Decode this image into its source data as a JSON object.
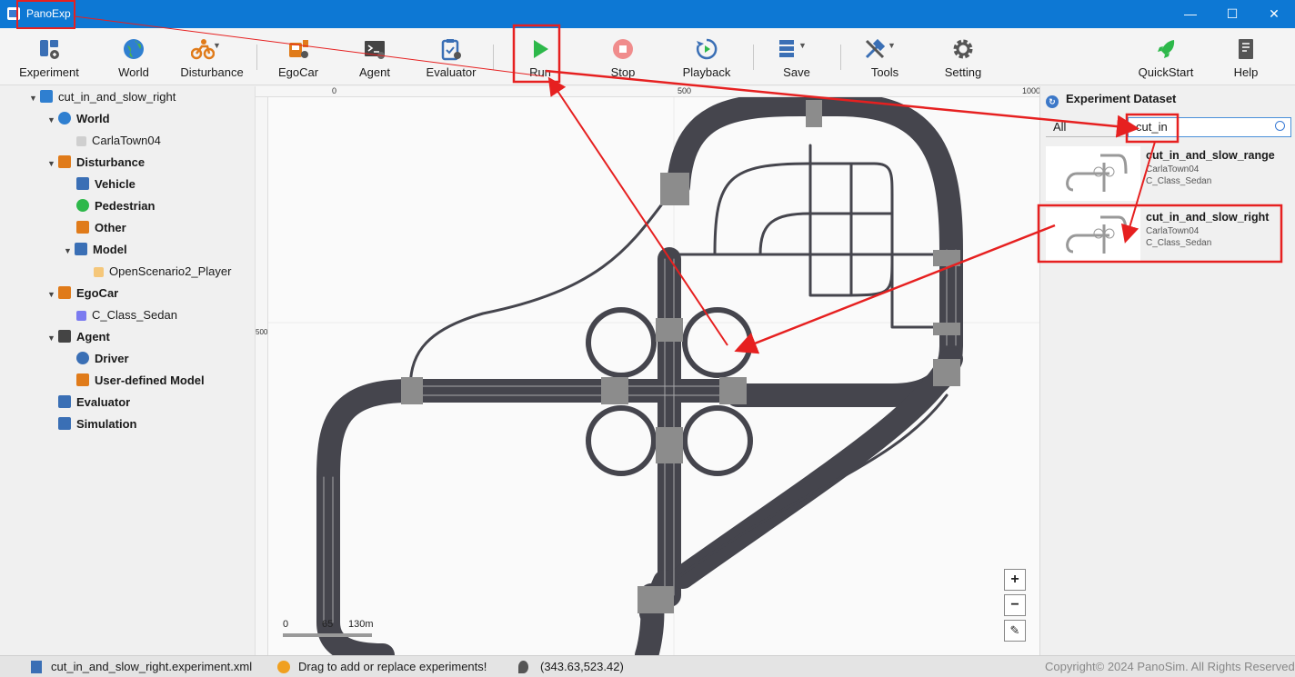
{
  "window": {
    "title": "PanoExp",
    "min": "—",
    "max": "☐",
    "close": "✕"
  },
  "toolbar": {
    "experiment": "Experiment",
    "world": "World",
    "disturbance": "Disturbance",
    "egocar": "EgoCar",
    "agent": "Agent",
    "evaluator": "Evaluator",
    "run": "Run",
    "stop": "Stop",
    "playback": "Playback",
    "save": "Save",
    "tools": "Tools",
    "setting": "Setting",
    "quickstart": "QuickStart",
    "help": "Help"
  },
  "tree": {
    "root": "cut_in_and_slow_right",
    "world": "World",
    "world_child": "CarlaTown04",
    "disturbance": "Disturbance",
    "vehicle": "Vehicle",
    "pedestrian": "Pedestrian",
    "other": "Other",
    "model": "Model",
    "model_child": "OpenScenario2_Player",
    "egocar": "EgoCar",
    "egocar_child": "C_Class_Sedan",
    "agent": "Agent",
    "driver": "Driver",
    "user_model": "User-defined Model",
    "evaluator": "Evaluator",
    "simulation": "Simulation"
  },
  "map": {
    "ruler_x": [
      "0",
      "500",
      "1000"
    ],
    "ruler_y": [
      "500"
    ],
    "scale": [
      "0",
      "65",
      "130m"
    ],
    "zoom_in": "+",
    "zoom_out": "−",
    "measure": "✎"
  },
  "panel": {
    "title": "Experiment Dataset",
    "filter": "All",
    "search_value": "cut_in",
    "items": [
      {
        "name": "cut_in_and_slow_range",
        "map": "CarlaTown04",
        "car": "C_Class_Sedan"
      },
      {
        "name": "cut_in_and_slow_right",
        "map": "CarlaTown04",
        "car": "C_Class_Sedan"
      }
    ]
  },
  "status": {
    "file": "cut_in_and_slow_right.experiment.xml",
    "hint": "Drag to add or replace experiments!",
    "coords": "(343.63,523.42)",
    "copyright": "Copyright© 2024 PanoSim. All Rights Reserved"
  },
  "colors": {
    "titlebar": "#0d78d4",
    "annotation": "#e62020",
    "run": "#2db84a",
    "stop": "#f08c8c",
    "road": "#45454d"
  }
}
